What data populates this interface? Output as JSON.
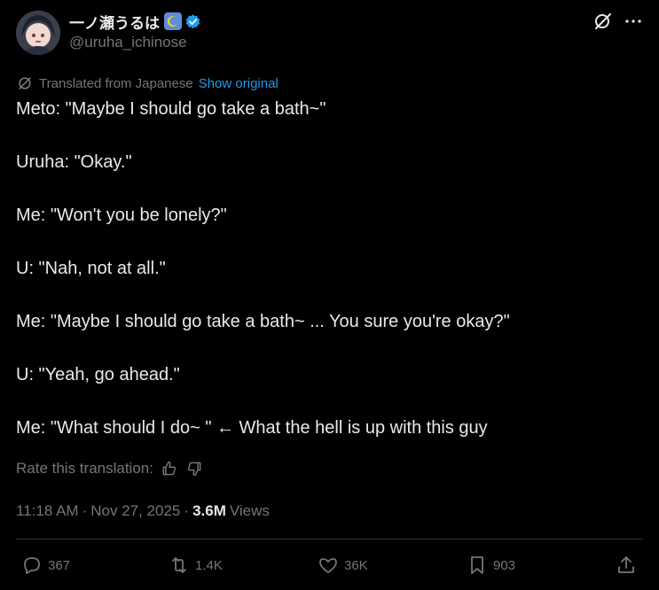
{
  "author": {
    "display_name": "一ノ瀬うるは",
    "handle": "@uruha_ichinose",
    "verified": true
  },
  "translation": {
    "note": "Translated from Japanese",
    "show_original": "Show original",
    "rate_label": "Rate this translation:"
  },
  "tweet": {
    "lines": [
      "Meto: \"Maybe I should go take a bath~\"",
      "Uruha: \"Okay.\"",
      "Me: \"Won't you be lonely?\"",
      "U: \"Nah, not at all.\"",
      "Me: \"Maybe I should go take a bath~ ... You sure you're okay?\"",
      "U: \"Yeah, go ahead.\"",
      "Me: \"What should I do~ \" ← What the hell is up with this guy"
    ]
  },
  "meta": {
    "time": "11:18 AM",
    "separator": "·",
    "date": "Nov 27, 2025",
    "views_count": "3.6M",
    "views_label": "Views"
  },
  "actions": {
    "replies": "367",
    "reposts": "1.4K",
    "likes": "36K",
    "bookmarks": "903"
  },
  "colors": {
    "background": "#000000",
    "text": "#e7e9ea",
    "muted": "#71767b",
    "link": "#1d9bf0",
    "verified": "#1d9bf0"
  }
}
